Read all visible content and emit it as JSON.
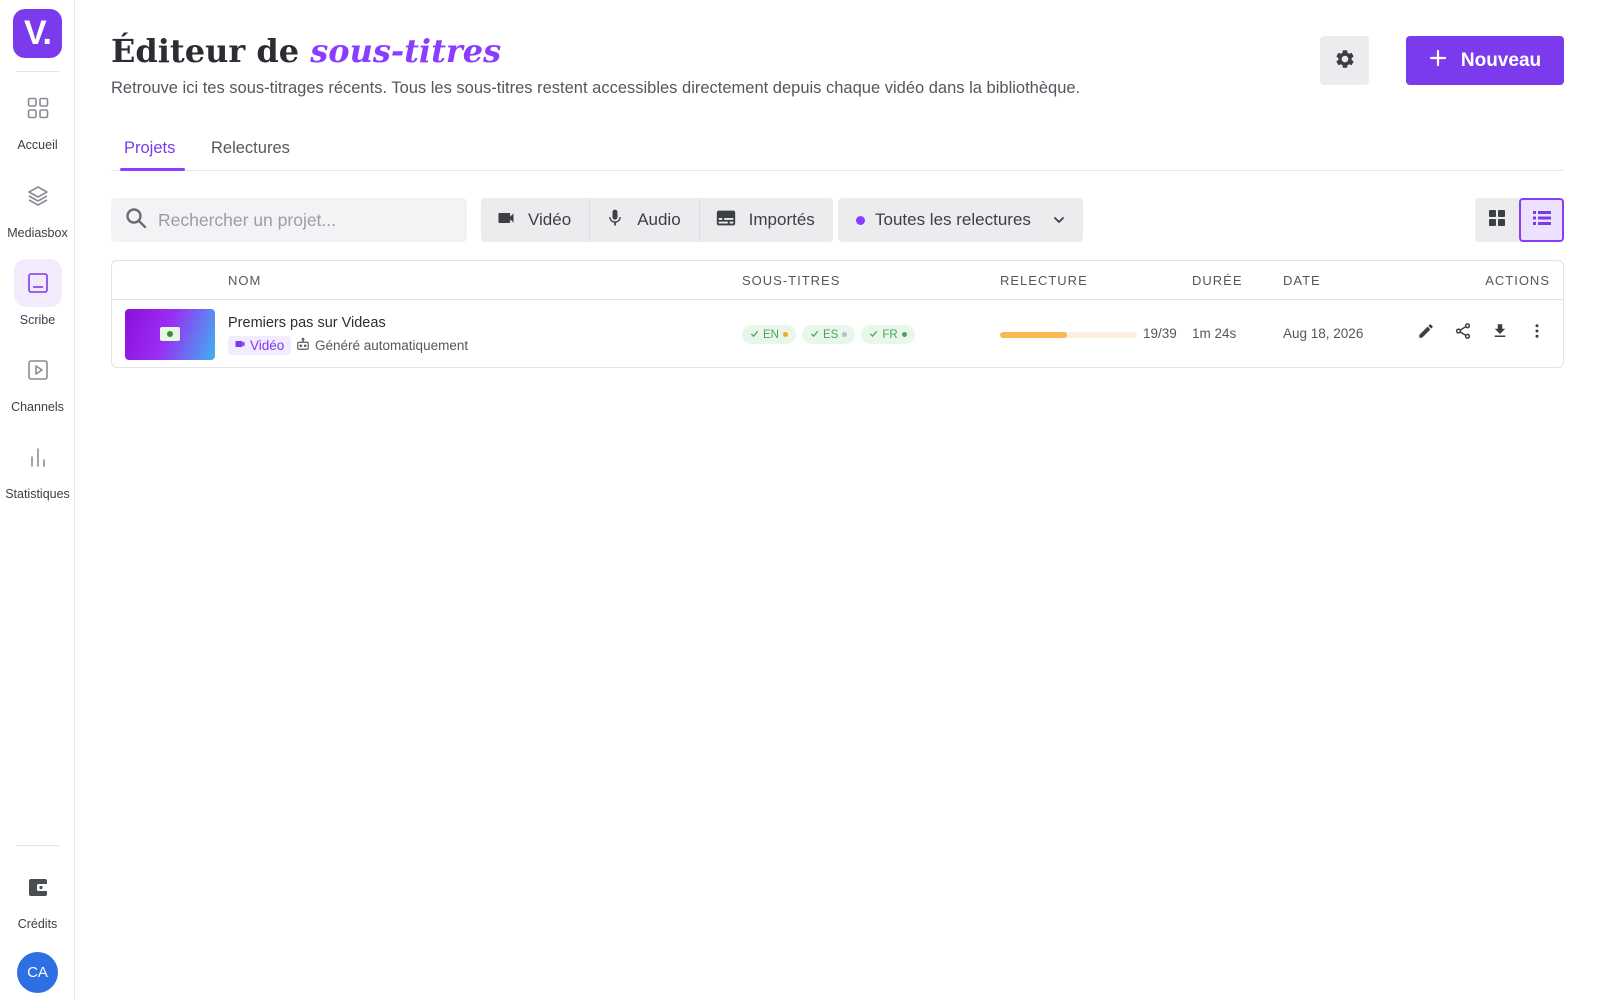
{
  "sidebar": {
    "logo": "V.",
    "items": [
      {
        "label": "Accueil",
        "icon": "grid-icon"
      },
      {
        "label": "Mediasbox",
        "icon": "layers-icon"
      },
      {
        "label": "Scribe",
        "icon": "subtitles-icon",
        "active": true
      },
      {
        "label": "Channels",
        "icon": "play-square-icon"
      },
      {
        "label": "Statistiques",
        "icon": "bar-chart-icon"
      }
    ],
    "credits_label": "Crédits",
    "avatar_initials": "CA"
  },
  "header": {
    "title_prefix": "Éditeur de ",
    "title_highlight": "sous-titres",
    "subtitle": "Retrouve ici tes sous-titrages récents. Tous les sous-titres restent accessibles directement depuis chaque vidéo dans la bibliothèque.",
    "new_button": "Nouveau"
  },
  "tabs": [
    {
      "label": "Projets",
      "active": true
    },
    {
      "label": "Relectures",
      "active": false
    }
  ],
  "filters": {
    "search_placeholder": "Rechercher un projet...",
    "types": [
      "Vidéo",
      "Audio",
      "Importés"
    ],
    "review_filter": "Toutes les relectures"
  },
  "table": {
    "columns": [
      "Nom",
      "Sous-titres",
      "Relecture",
      "Durée",
      "Date",
      "Actions"
    ],
    "rows": [
      {
        "name": "Premiers pas sur Videas",
        "type_badge": "Vidéo",
        "origin": "Généré automatiquement",
        "languages": [
          {
            "code": "EN",
            "dot_color": "#f5a623"
          },
          {
            "code": "ES",
            "dot_color": "#b8bcc4"
          },
          {
            "code": "FR",
            "dot_color": "#46a55a"
          }
        ],
        "review_progress": "19/39",
        "review_fraction": 0.487,
        "duration": "1m 24s",
        "date": "Aug 18, 2026"
      }
    ]
  },
  "colors": {
    "accent": "#7c3aed",
    "progress": "#f8b84e"
  }
}
